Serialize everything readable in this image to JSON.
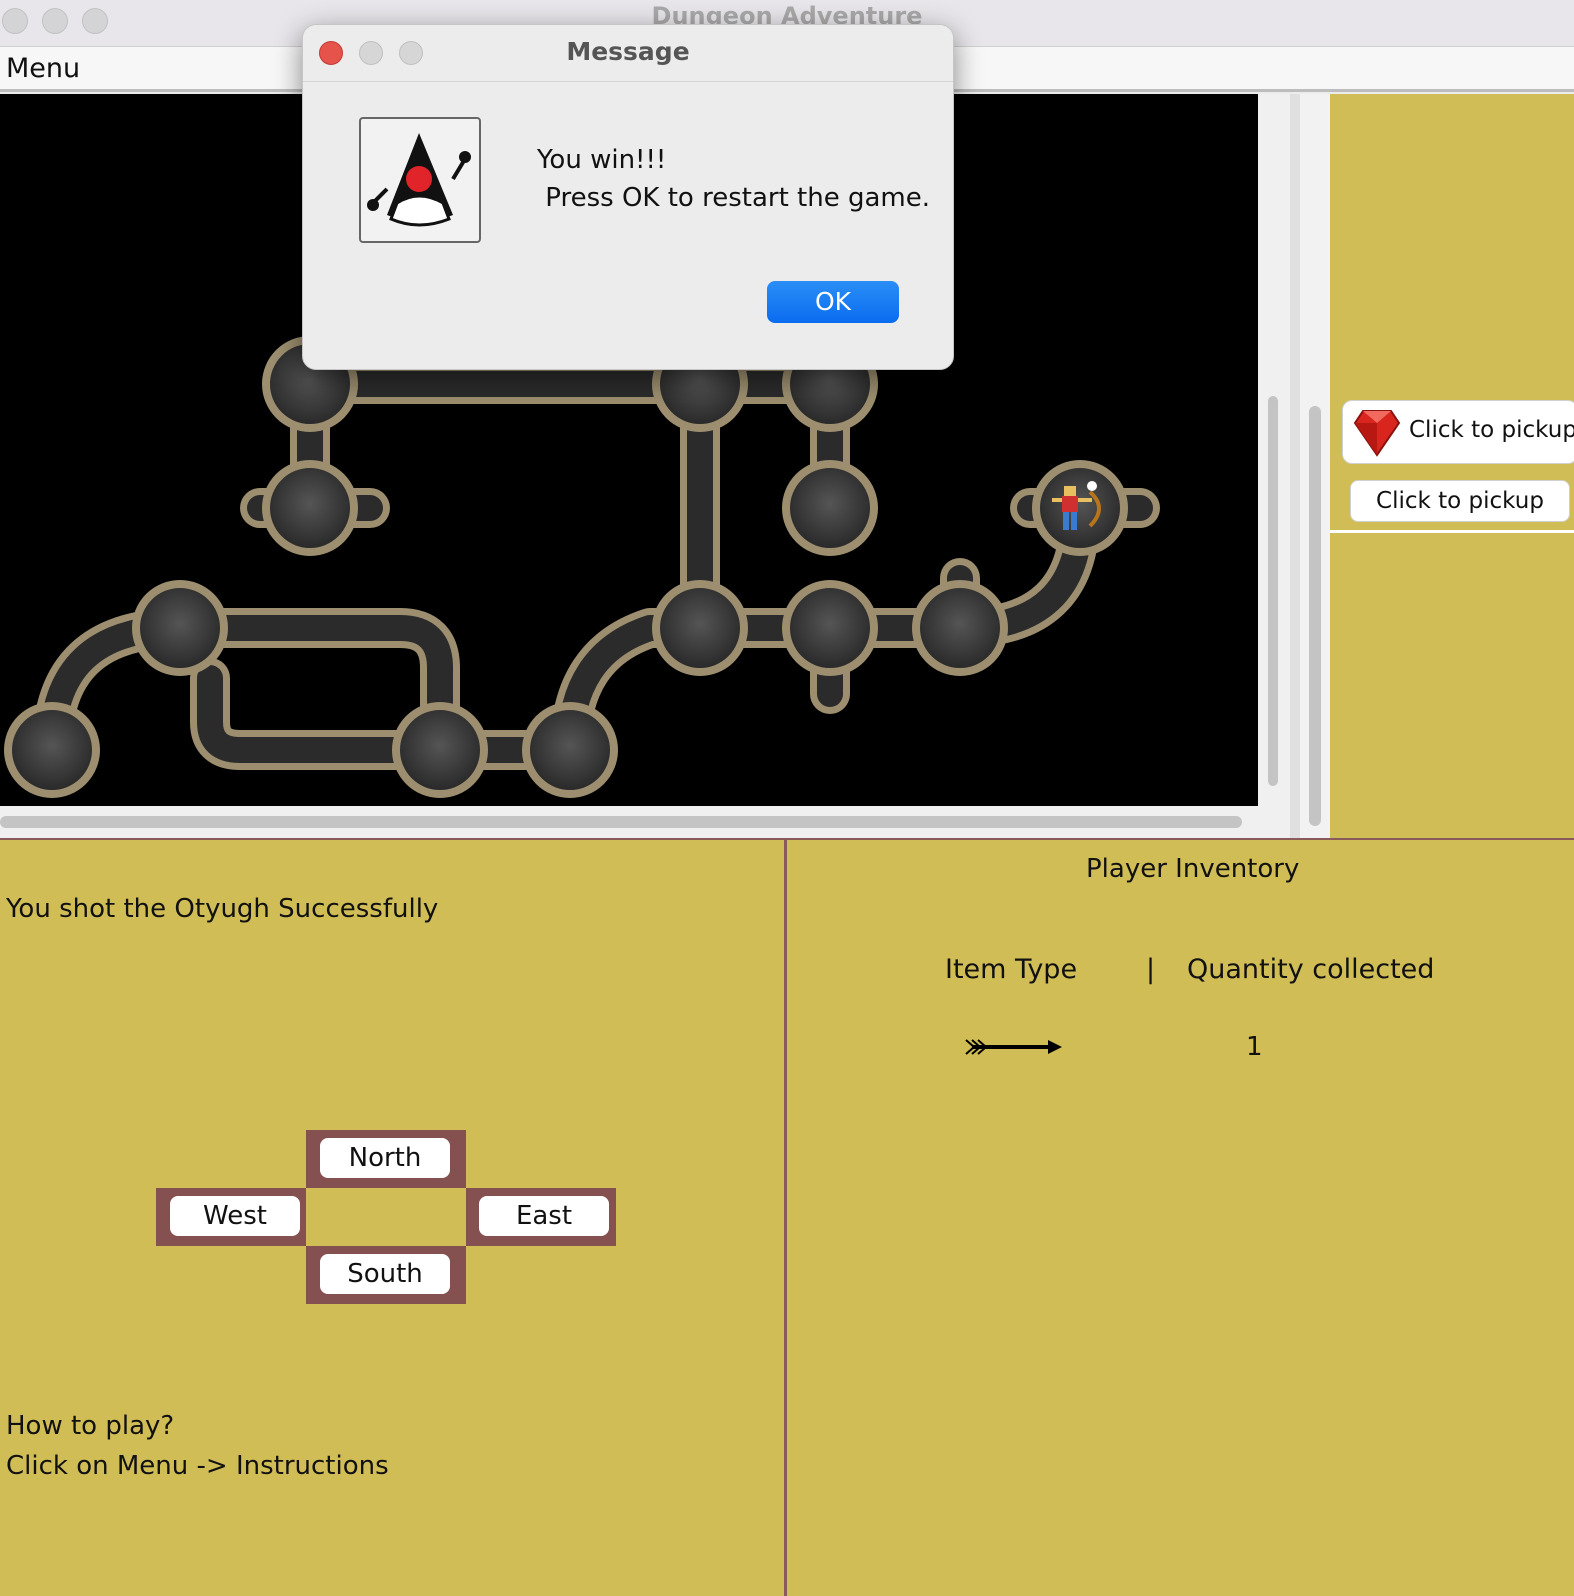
{
  "window": {
    "title": "Dungeon Adventure"
  },
  "menubar": {
    "menu_label": "Menu"
  },
  "dialog": {
    "title": "Message",
    "message": "You win!!!\n Press OK to restart the game.",
    "ok_label": "OK",
    "icon": "duke-icon"
  },
  "side_panel": {
    "pickup_buttons": [
      {
        "label": "Click to pickup",
        "icon": "gem-icon"
      },
      {
        "label": "Click to pickup"
      }
    ]
  },
  "controls": {
    "status": "You shot the Otyugh Successfully",
    "north": "North",
    "west": "West",
    "east": "East",
    "south": "South",
    "howto_line1": "How to play?",
    "howto_line2": "Click on Menu -> Instructions"
  },
  "inventory": {
    "title": "Player Inventory",
    "col_item": "Item Type",
    "col_sep": "|",
    "col_qty": "Quantity collected",
    "rows": [
      {
        "item_icon": "arrow-icon",
        "quantity": "1"
      }
    ]
  },
  "colors": {
    "panel_bg": "#d1bd56",
    "border": "#8a5a5a",
    "ok_button": "#0a6cf0",
    "close_light": "#e5534b"
  }
}
